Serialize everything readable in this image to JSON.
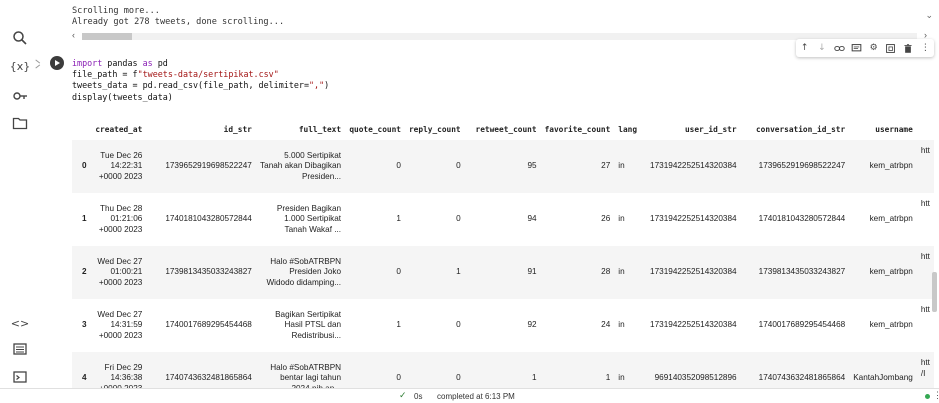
{
  "output": {
    "line1": "Scrolling more...",
    "line2": "Already got 278 tweets, done scrolling..."
  },
  "rail_icons": [
    "search-icon",
    "variables-icon",
    "secrets-icon",
    "files-icon",
    "code-snippets-icon",
    "command-palette-icon",
    "terminal-icon"
  ],
  "toolbar_icons": [
    "move-up-icon",
    "move-down-icon",
    "link-icon",
    "comment-icon",
    "settings-icon",
    "mirror-icon",
    "delete-icon",
    "more-icon"
  ],
  "code": {
    "l1_kw1": "import",
    "l1_mid": " pandas ",
    "l1_kw2": "as",
    "l1_end": " pd",
    "l2_a": "file_path = f",
    "l2_str": "\"tweets-data/sertipikat.csv\"",
    "l3_a": "tweets_data = pd.read_csv(file_path, delimiter=",
    "l3_str": "\",\"",
    "l3_end": ")",
    "l4": "display(tweets_data)"
  },
  "table": {
    "columns": [
      "",
      "created_at",
      "id_str",
      "full_text",
      "quote_count",
      "reply_count",
      "retweet_count",
      "favorite_count",
      "lang",
      "user_id_str",
      "conversation_id_str",
      "username",
      ""
    ],
    "rows": [
      {
        "idx": "0",
        "created_at": "Tue Dec 26 14:22:31 +0000 2023",
        "id_str": "1739652919698522247",
        "full_text": "5.000 Sertipikat Tanah akan Dibagikan Presiden...",
        "quote_count": "0",
        "reply_count": "0",
        "retweet_count": "95",
        "favorite_count": "27",
        "lang": "in",
        "user_id_str": "1731942252514320384",
        "conversation_id_str": "1739652919698522247",
        "username": "kem_atrbpn",
        "tail": "htt"
      },
      {
        "idx": "1",
        "created_at": "Thu Dec 28 01:21:06 +0000 2023",
        "id_str": "1740181043280572844",
        "full_text": "Presiden Bagikan 1.000 Sertipikat Tanah Wakaf ...",
        "quote_count": "1",
        "reply_count": "0",
        "retweet_count": "94",
        "favorite_count": "26",
        "lang": "in",
        "user_id_str": "1731942252514320384",
        "conversation_id_str": "1740181043280572844",
        "username": "kem_atrbpn",
        "tail": "htt"
      },
      {
        "idx": "2",
        "created_at": "Wed Dec 27 01:00:21 +0000 2023",
        "id_str": "1739813435033243827",
        "full_text": "Halo #SobATRBPN Presiden Joko Widodo didamping...",
        "quote_count": "0",
        "reply_count": "1",
        "retweet_count": "91",
        "favorite_count": "28",
        "lang": "in",
        "user_id_str": "1731942252514320384",
        "conversation_id_str": "1739813435033243827",
        "username": "kem_atrbpn",
        "tail": "htt"
      },
      {
        "idx": "3",
        "created_at": "Wed Dec 27 14:31:59 +0000 2023",
        "id_str": "1740017689295454468",
        "full_text": "Bagikan Sertipikat Hasil PTSL dan Redistribusi...",
        "quote_count": "1",
        "reply_count": "0",
        "retweet_count": "92",
        "favorite_count": "24",
        "lang": "in",
        "user_id_str": "1731942252514320384",
        "conversation_id_str": "1740017689295454468",
        "username": "kem_atrbpn",
        "tail": "htt"
      },
      {
        "idx": "4",
        "created_at": "Fri Dec 29 14:36:38 +0000 2023",
        "id_str": "1740743632481865864",
        "full_text": "Halo #SobATRBPN bentar lagi tahun 2024 nih ap...",
        "quote_count": "0",
        "reply_count": "0",
        "retweet_count": "1",
        "favorite_count": "1",
        "lang": "in",
        "user_id_str": "969140352098512896",
        "conversation_id_str": "1740743632481865864",
        "username": "KantahJombang",
        "tail": "htt /I"
      }
    ]
  },
  "status": {
    "elapsed": "0s",
    "message": "completed at 6:13 PM"
  }
}
